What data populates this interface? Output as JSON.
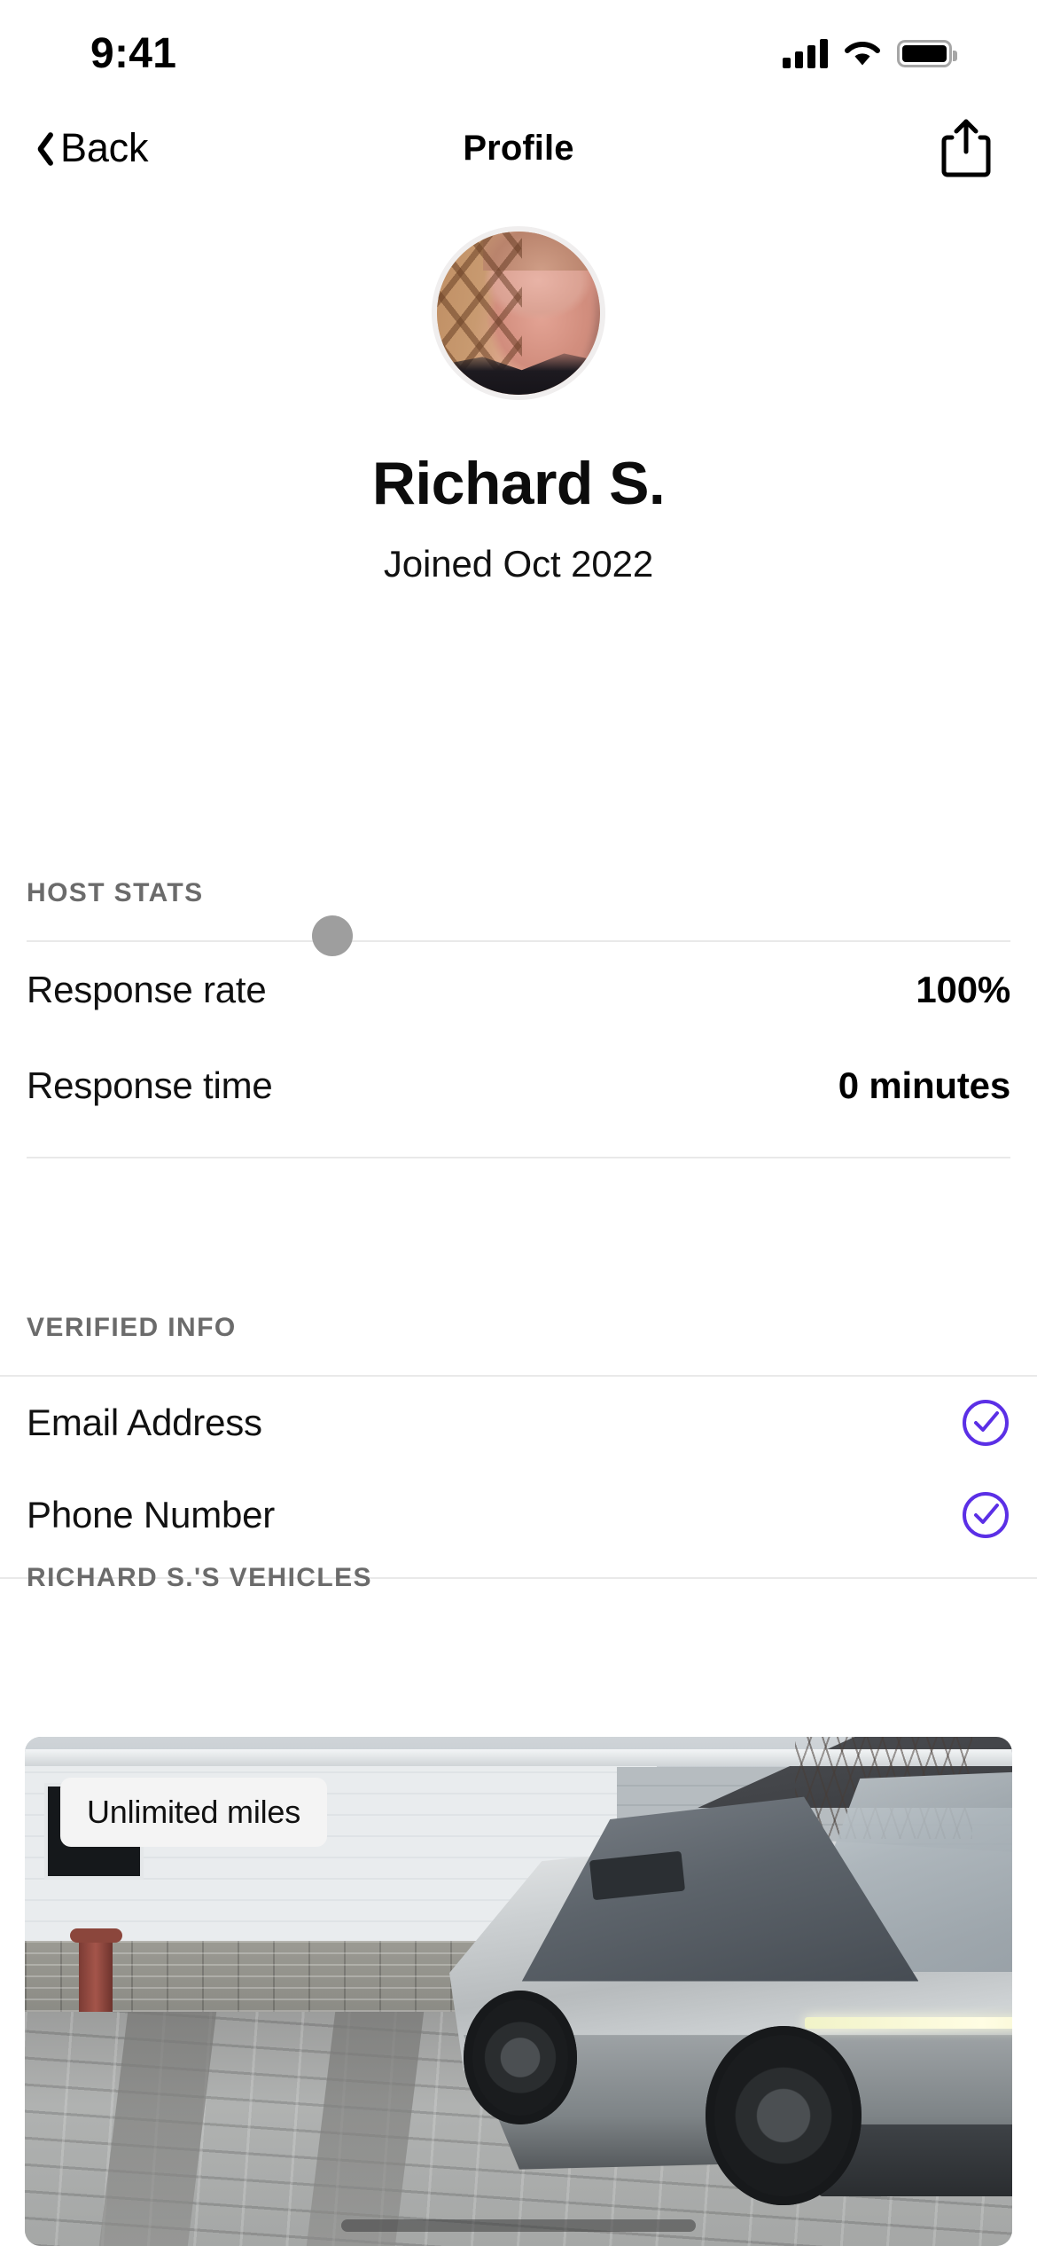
{
  "status_bar": {
    "time": "9:41",
    "signal_icon": "cellular-signal-icon",
    "wifi_icon": "wifi-icon",
    "battery_icon": "battery-full-icon"
  },
  "nav": {
    "back_label": "Back",
    "back_icon": "chevron-left-icon",
    "title": "Profile",
    "share_icon": "share-icon"
  },
  "profile": {
    "avatar_alt": "profile-photo",
    "name": "Richard S.",
    "joined": "Joined Oct 2022"
  },
  "host_stats": {
    "title": "HOST STATS",
    "rows": [
      {
        "label": "Response rate",
        "value": "100%"
      },
      {
        "label": "Response time",
        "value": "0 minutes"
      }
    ]
  },
  "verified_info": {
    "title": "VERIFIED INFO",
    "rows": [
      {
        "label": "Email Address",
        "icon": "check-circle-icon",
        "verified": true
      },
      {
        "label": "Phone Number",
        "icon": "check-circle-icon",
        "verified": true
      }
    ]
  },
  "vehicles": {
    "title": "RICHARD S.'S VEHICLES",
    "cards": [
      {
        "badge": "Unlimited miles",
        "photo_alt": "cybertruck-photo"
      }
    ]
  },
  "colors": {
    "accent_purple": "#5B2FE6",
    "section_title_gray": "#6B6B6B",
    "divider": "#E9E9E9",
    "badge_bg": "#F4F4F4"
  }
}
